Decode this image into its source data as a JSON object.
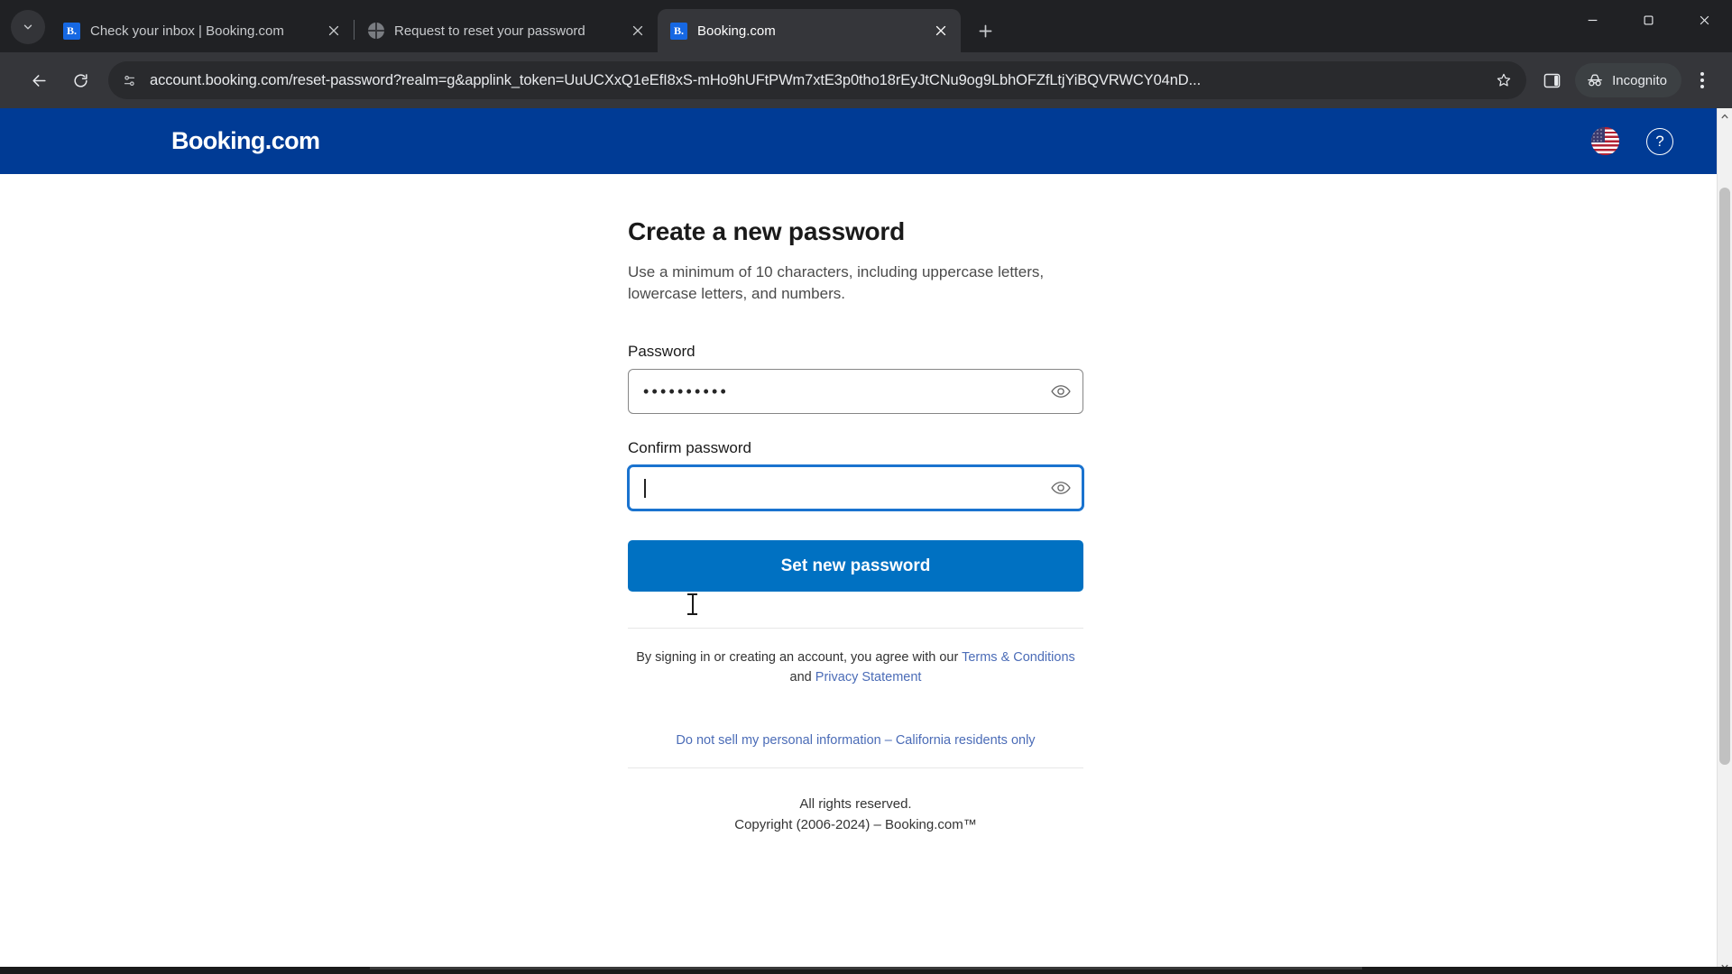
{
  "browser": {
    "tab_search_icon": "chevron-down-icon",
    "tabs": [
      {
        "title": "Check your inbox | Booking.com",
        "favicon": "booking-favicon",
        "favicon_letter": "B.",
        "active": false,
        "close_label": "×"
      },
      {
        "title": "Request to reset your password",
        "favicon": "globe-favicon",
        "favicon_letter": "",
        "active": false,
        "close_label": "×"
      },
      {
        "title": "Booking.com",
        "favicon": "booking-favicon",
        "favicon_letter": "B.",
        "active": true,
        "close_label": "×"
      }
    ],
    "new_tab_label": "+",
    "window_controls": {
      "minimize": "—",
      "maximize": "❐",
      "close": "✕"
    },
    "nav": {
      "back": "back-arrow-icon",
      "forward": "forward-arrow-icon",
      "reload": "reload-icon"
    },
    "omnibox": {
      "site_info_icon": "site-settings-icon",
      "url": "account.booking.com/reset-password?realm=g&applink_token=UuUCXxQ1eEfI8xS-mHo9hUFtPWm7xtE3p0tho18rEyJtCNu9og9LbhOFZfLtjYiBQVRWCY04nD...",
      "bookmark_icon": "star-icon"
    },
    "side_panel_icon": "side-panel-icon",
    "incognito": {
      "label": "Incognito",
      "icon": "incognito-icon"
    },
    "menu_icon": "three-dot-menu-icon"
  },
  "site": {
    "header": {
      "logo": "Booking.com",
      "language_icon": "us-flag-icon",
      "help_label": "?"
    },
    "form": {
      "title": "Create a new password",
      "description": "Use a minimum of 10 characters, including uppercase letters, lowercase letters, and numbers.",
      "password": {
        "label": "Password",
        "value": "••••••••••",
        "placeholder": "",
        "toggle_icon": "eye-icon"
      },
      "confirm_password": {
        "label": "Confirm password",
        "value": "",
        "placeholder": "",
        "toggle_icon": "eye-icon"
      },
      "submit_label": "Set new password"
    },
    "footer": {
      "legal_prefix": "By signing in or creating an account, you agree with our ",
      "terms_link": "Terms & Conditions",
      "legal_middle": " and ",
      "privacy_link": "Privacy Statement",
      "ccpa_link": "Do not sell my personal information – California residents only",
      "rights": "All rights reserved.",
      "copyright": "Copyright (2006-2024) – Booking.com™"
    }
  },
  "colors": {
    "brand_blue": "#003b95",
    "action_blue": "#0071c2",
    "focus_blue": "#1a73cf",
    "link_blue": "#4b6cb7"
  }
}
